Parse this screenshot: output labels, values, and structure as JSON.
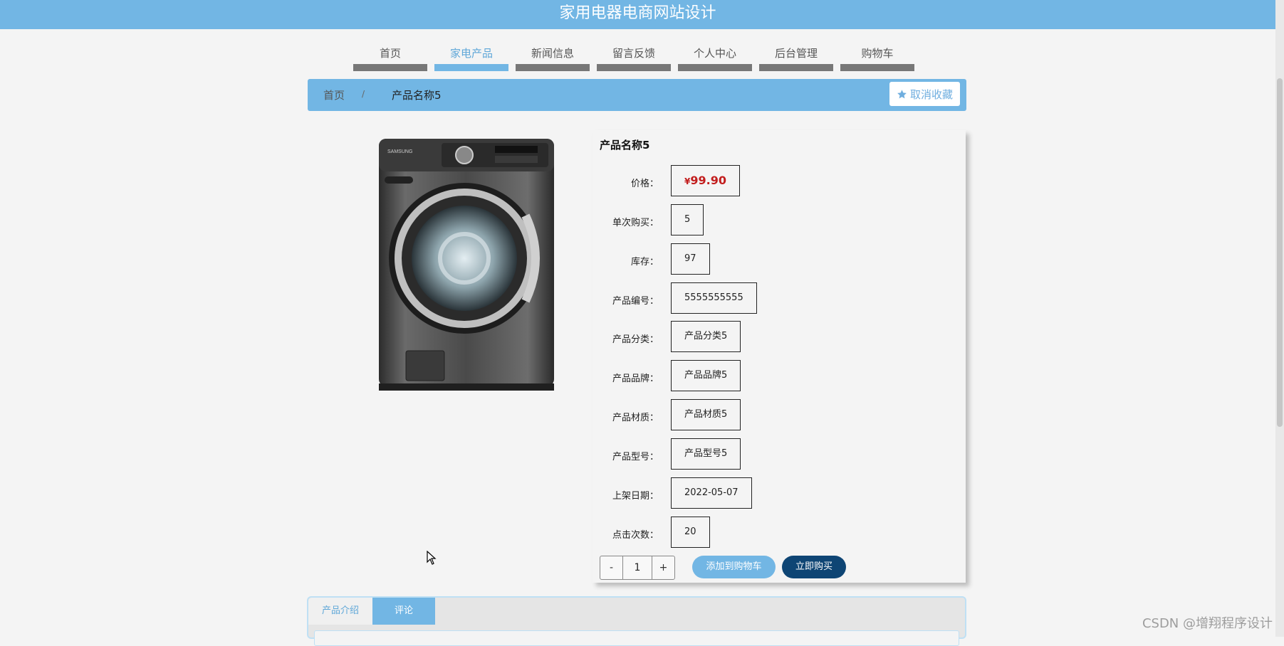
{
  "header": {
    "title": "家用电器电商网站设计"
  },
  "nav": {
    "items": [
      {
        "label": "首页"
      },
      {
        "label": "家电产品"
      },
      {
        "label": "新闻信息"
      },
      {
        "label": "留言反馈"
      },
      {
        "label": "个人中心"
      },
      {
        "label": "后台管理"
      },
      {
        "label": "购物车"
      }
    ],
    "active": "家电产品"
  },
  "breadcrumb": {
    "home": "首页",
    "separator": "/",
    "current": "产品名称5"
  },
  "favorite_button": {
    "label": "取消收藏",
    "icon": "star-icon"
  },
  "product": {
    "name": "产品名称5",
    "fields": [
      {
        "label": "价格：",
        "currency": "¥",
        "value": "99.90"
      },
      {
        "label": "单次购买：",
        "value": "5"
      },
      {
        "label": "库存：",
        "value": "97"
      },
      {
        "label": "产品编号：",
        "value": "5555555555"
      },
      {
        "label": "产品分类：",
        "value": "产品分类5"
      },
      {
        "label": "产品品牌：",
        "value": "产品品牌5"
      },
      {
        "label": "产品材质：",
        "value": "产品材质5"
      },
      {
        "label": "产品型号：",
        "value": "产品型号5"
      },
      {
        "label": "上架日期：",
        "value": "2022-05-07"
      },
      {
        "label": "点击次数：",
        "value": "20"
      }
    ],
    "image_brand": "SAMSUNG"
  },
  "quantity": {
    "minus": "-",
    "value": "1",
    "plus": "+"
  },
  "actions": {
    "add_to_cart": "添加到购物车",
    "buy_now": "立即购买"
  },
  "tabs": [
    {
      "label": "产品介绍"
    },
    {
      "label": "评论"
    }
  ],
  "watermark": "CSDN @增翔程序设计",
  "colors": {
    "primary": "#72b6e4",
    "dark_button": "#0e4574",
    "price": "#c21d1d"
  }
}
